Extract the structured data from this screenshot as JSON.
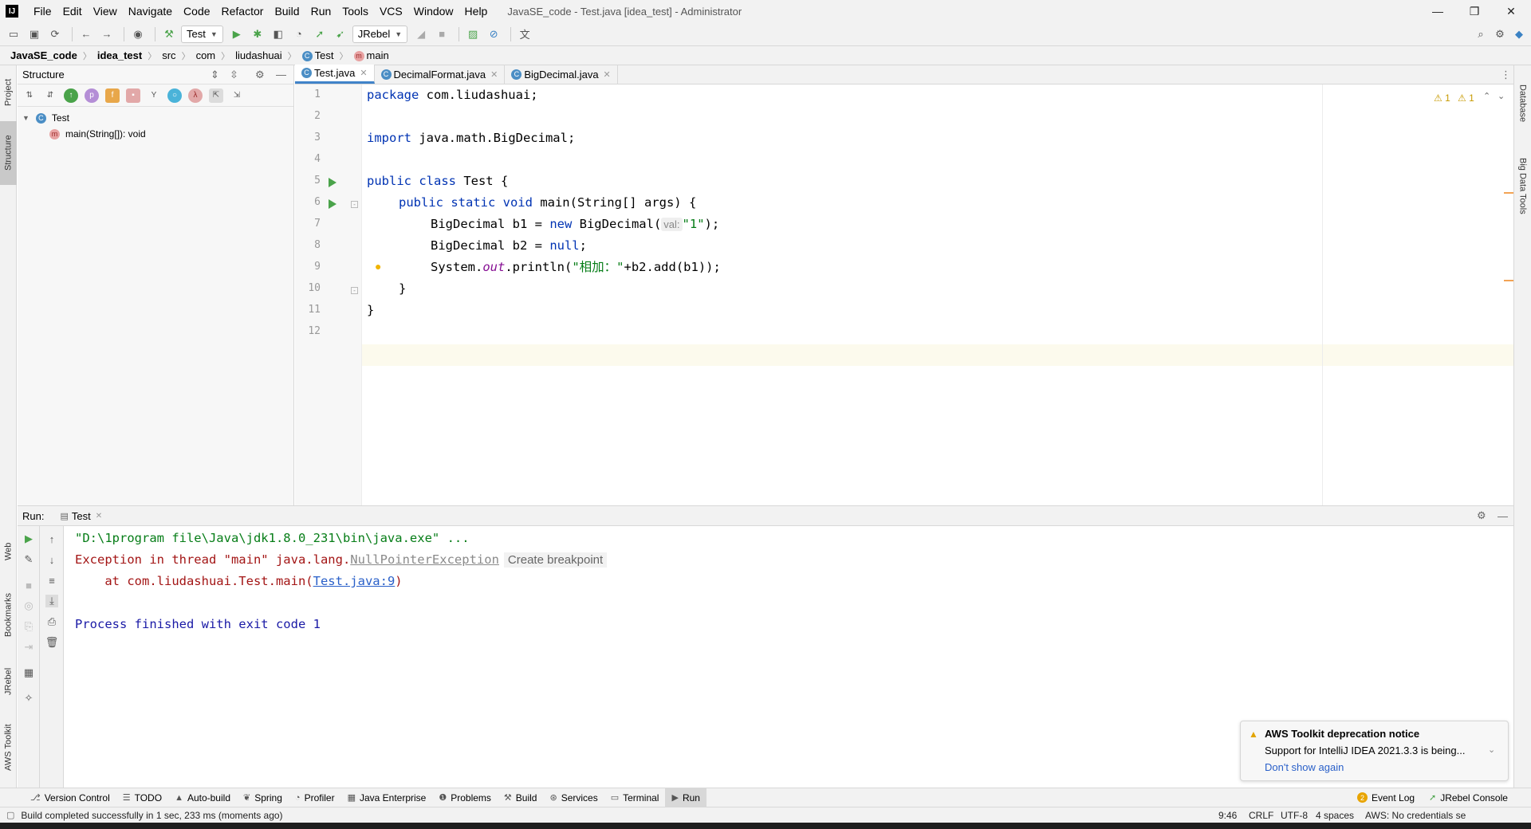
{
  "window": {
    "title": "JavaSE_code - Test.java [idea_test] - Administrator",
    "controls": {
      "minimize": "—",
      "maximize": "❐",
      "close": "✕"
    }
  },
  "menu": [
    "File",
    "Edit",
    "View",
    "Navigate",
    "Code",
    "Refactor",
    "Build",
    "Run",
    "Tools",
    "VCS",
    "Window",
    "Help"
  ],
  "toolbar": {
    "run_config": "Test",
    "jrebel": "JRebel"
  },
  "breadcrumb": [
    "JavaSE_code",
    "idea_test",
    "src",
    "com",
    "liudashuai",
    "Test",
    "main"
  ],
  "left_stripe": [
    "Project",
    "Structure",
    "Web",
    "Bookmarks",
    "JRebel",
    "AWS Toolkit"
  ],
  "right_stripe": [
    "Database",
    "Big Data Tools"
  ],
  "structure": {
    "title": "Structure",
    "tree": [
      {
        "label": "Test",
        "kind": "class"
      },
      {
        "label": "main(String[]): void",
        "kind": "method"
      }
    ]
  },
  "editor": {
    "tabs": [
      {
        "label": "Test.java",
        "active": true
      },
      {
        "label": "DecimalFormat.java",
        "active": false
      },
      {
        "label": "BigDecimal.java",
        "active": false
      }
    ],
    "inspections": {
      "warnings": "1",
      "weak_warnings": "1"
    },
    "line_numbers": [
      "1",
      "2",
      "3",
      "4",
      "5",
      "6",
      "7",
      "8",
      "9",
      "10",
      "11",
      "12"
    ],
    "code": {
      "l1_kw": "package",
      "l1_rest": " com.liudashuai;",
      "l3_kw": "import",
      "l3_rest": " java.math.BigDecimal;",
      "l5_kw": "public class",
      "l5_rest": " Test {",
      "l6_kw": "public static void",
      "l6_rest": " main(String[] args) {",
      "l7_a": "BigDecimal b1 = ",
      "l7_kw": "new",
      "l7_b": " BigDecimal(",
      "l7_hint": "val:",
      "l7_str": "\"1\"",
      "l7_c": ");",
      "l8_a": "BigDecimal b2 = ",
      "l8_kw": "null",
      "l8_b": ";",
      "l9_a": "System.",
      "l9_fld": "out",
      "l9_b": ".println(",
      "l9_str": "\"相加：\"",
      "l9_c": "+b2.add(b1));",
      "l10": "}",
      "l11": "}"
    }
  },
  "run": {
    "label": "Run:",
    "tab": "Test",
    "console": {
      "cmd": "\"D:\\1program file\\Java\\jdk1.8.0_231\\bin\\java.exe\" ...",
      "exc_prefix": "Exception in thread \"main\" java.lang.",
      "exc_name": "NullPointerException",
      "exc_action": "Create breakpoint",
      "at_prefix": "    at com.liudashuai.Test.main(",
      "at_link": "Test.java:9",
      "at_suffix": ")",
      "finished": "Process finished with exit code 1"
    }
  },
  "notification": {
    "title": "AWS Toolkit deprecation notice",
    "body": "Support for IntelliJ IDEA 2021.3.3 is being...",
    "action": "Don't show again"
  },
  "bottom_tools": [
    "Version Control",
    "TODO",
    "Auto-build",
    "Spring",
    "Profiler",
    "Java Enterprise",
    "Problems",
    "Build",
    "Services",
    "Terminal",
    "Run"
  ],
  "bottom_right": {
    "event_log": "Event Log",
    "event_count": "2",
    "jrebel_console": "JRebel Console"
  },
  "status": {
    "message": "Build completed successfully in 1 sec, 233 ms (moments ago)",
    "position": "9:46",
    "line_sep": "CRLF",
    "encoding": "UTF-8",
    "indent": "4 spaces",
    "aws": "AWS: No credentials se"
  },
  "colors": {
    "keyword": "#0033b3",
    "string": "#067d17",
    "error_red": "#a31515",
    "link": "#2a60c9",
    "tab_underline": "#4083c9"
  }
}
